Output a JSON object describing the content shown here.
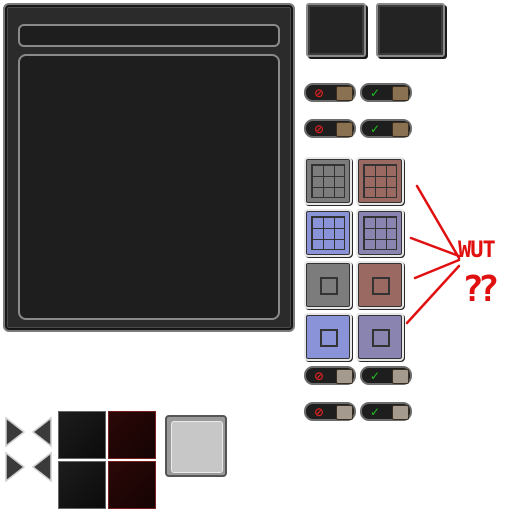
{
  "main_panel": {
    "title": "",
    "content": ""
  },
  "tabs": [
    {
      "label": ""
    },
    {
      "label": ""
    }
  ],
  "toggle_rows": [
    {
      "deny_symbol": "⊘",
      "allow_symbol": "✓",
      "knob": "wood"
    },
    {
      "deny_symbol": "⊘",
      "allow_symbol": "✓",
      "knob": "wood"
    },
    {
      "deny_symbol": "⊘",
      "allow_symbol": "✓",
      "knob": "stone"
    },
    {
      "deny_symbol": "⊘",
      "allow_symbol": "✓",
      "knob": "stone"
    }
  ],
  "slot_colors": {
    "gray": "#7c7c7c",
    "brown": "#9a6a62",
    "blue": "#8a93d8",
    "purple": "#8a84b0"
  },
  "annotation": {
    "line1": "WUT",
    "line2": "??"
  },
  "colors": {
    "panel_bg": "#2b2b2b",
    "panel_border": "#8a8a8a",
    "deny": "#e02020",
    "allow": "#20c020",
    "annotation": "#e01010"
  },
  "icons": [
    "deny-icon",
    "checkmark-icon",
    "arrow-right-icon",
    "arrow-left-icon"
  ]
}
